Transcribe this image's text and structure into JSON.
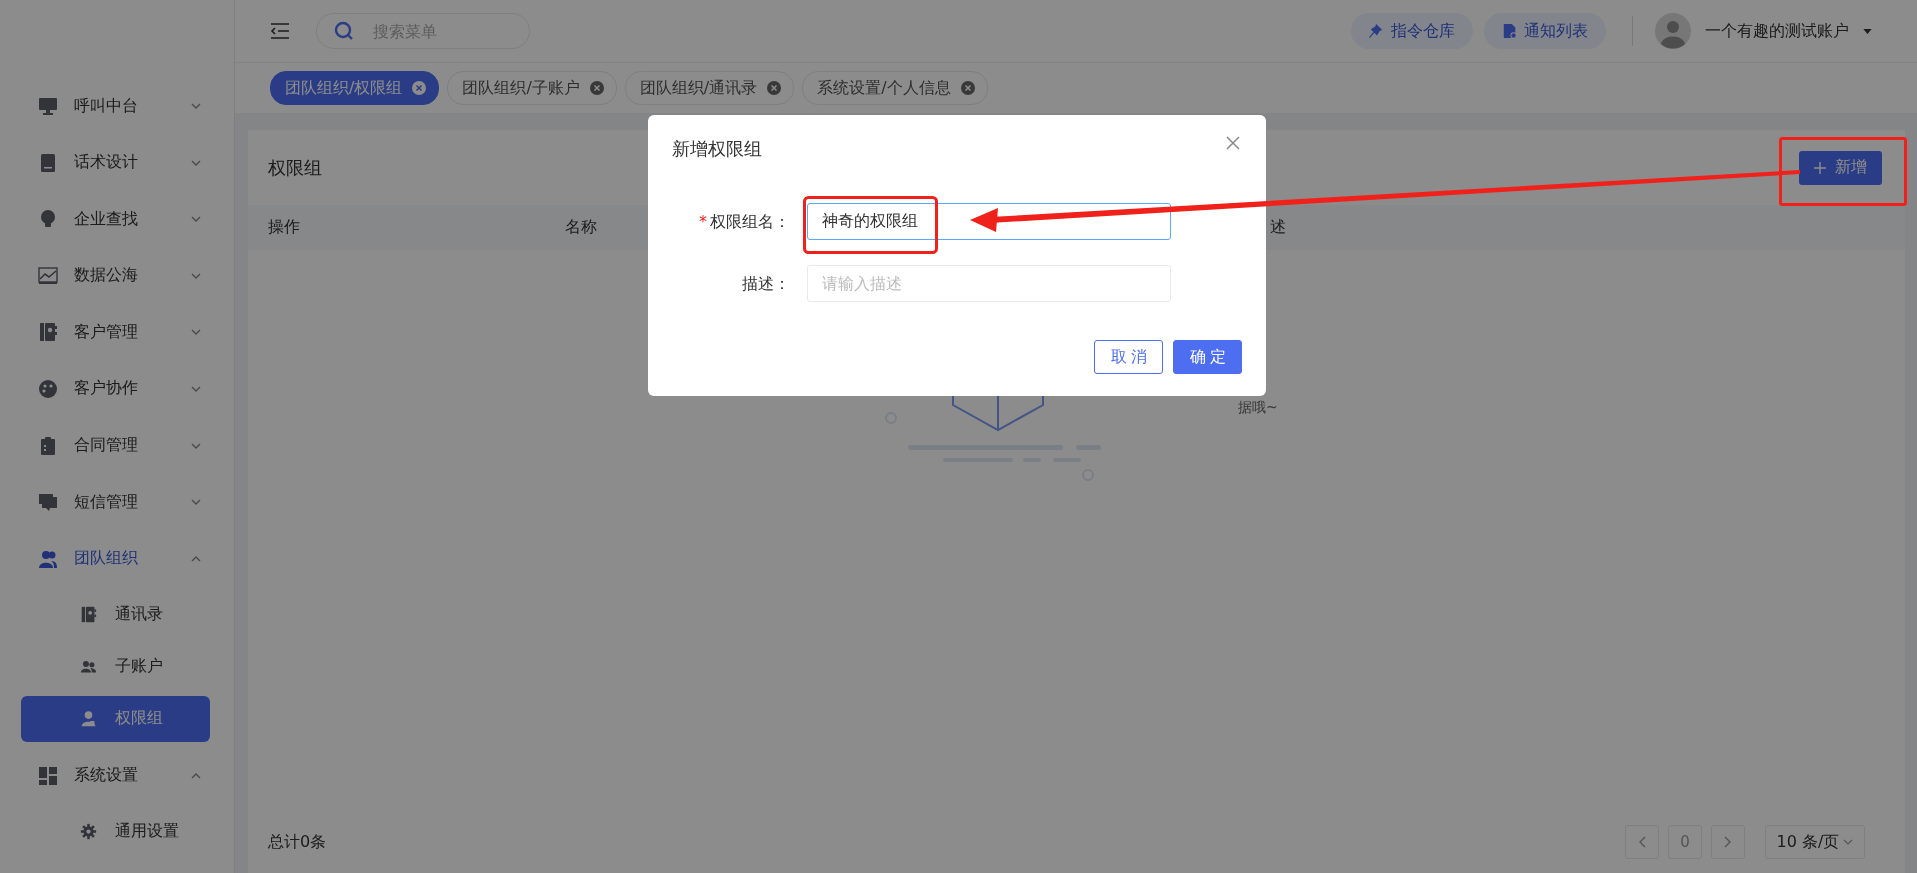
{
  "header": {
    "search": {
      "placeholder": "搜索菜单"
    },
    "buttons": [
      {
        "label": "指令仓库"
      },
      {
        "label": "通知列表"
      }
    ],
    "user": {
      "name": "一个有趣的测试账户"
    }
  },
  "tabs": [
    {
      "label": "团队组织/权限组",
      "selected": true
    },
    {
      "label": "团队组织/子账户",
      "selected": false
    },
    {
      "label": "团队组织/通讯录",
      "selected": false
    },
    {
      "label": "系统设置/个人信息",
      "selected": false
    }
  ],
  "sidebar": {
    "items": [
      {
        "label": "呼叫中台",
        "expanded": false,
        "active": false
      },
      {
        "label": "话术设计",
        "expanded": false,
        "active": false
      },
      {
        "label": "企业查找",
        "expanded": false,
        "active": false
      },
      {
        "label": "数据公海",
        "expanded": false,
        "active": false
      },
      {
        "label": "客户管理",
        "expanded": false,
        "active": false
      },
      {
        "label": "客户协作",
        "expanded": false,
        "active": false
      },
      {
        "label": "合同管理",
        "expanded": false,
        "active": false
      },
      {
        "label": "短信管理",
        "expanded": false,
        "active": false
      },
      {
        "label": "团队组织",
        "expanded": true,
        "active": true,
        "children": [
          {
            "label": "通讯录",
            "selected": false
          },
          {
            "label": "子账户",
            "selected": false
          },
          {
            "label": "权限组",
            "selected": true
          }
        ]
      },
      {
        "label": "系统设置",
        "expanded": true,
        "active": false,
        "children": [
          {
            "label": "通用设置",
            "selected": false
          }
        ]
      }
    ]
  },
  "page": {
    "title": "权限组",
    "add_button": "新增",
    "columns": [
      "操作",
      "名称",
      "述"
    ],
    "empty_text": "据哦~",
    "total": "总计0条",
    "pagination": {
      "page": "0",
      "page_size": "10 条/页"
    }
  },
  "dialog": {
    "title": "新增权限组",
    "fields": [
      {
        "label": "权限组名：",
        "mark": "*",
        "value": "神奇的权限组",
        "focused": true
      },
      {
        "label": "描述：",
        "placeholder": "请输入描述",
        "focused": false
      }
    ],
    "buttons": [
      {
        "label": "取消",
        "kind": "secondary"
      },
      {
        "label": "确定",
        "kind": "primary"
      }
    ]
  }
}
